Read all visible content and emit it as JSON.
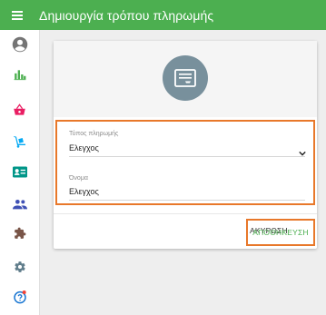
{
  "appbar": {
    "title": "Δημιουργία τρόπου πληρωμής",
    "menu_icon": "hamburger-menu-icon",
    "color": "#4caf50"
  },
  "sidebar": {
    "items": [
      {
        "icon": "account-circle-icon",
        "color": "#757575"
      },
      {
        "icon": "bar-chart-icon",
        "color": "#4caf50"
      },
      {
        "icon": "basket-icon",
        "color": "#e91e63"
      },
      {
        "icon": "delivery-icon",
        "color": "#03a9f4"
      },
      {
        "icon": "id-card-icon",
        "color": "#009688"
      },
      {
        "icon": "people-icon",
        "color": "#3f51b5"
      },
      {
        "icon": "puzzle-icon",
        "color": "#795548"
      },
      {
        "icon": "gear-icon",
        "color": "#607d8b"
      },
      {
        "icon": "help-icon",
        "color": "#1976d2"
      }
    ]
  },
  "form": {
    "avatar_icon": "receipt-icon",
    "payment_type": {
      "label": "Τύπος πληρωμής",
      "value": "Ελεγχος"
    },
    "name": {
      "label": "Όνομα",
      "value": "Ελεγχος"
    },
    "cancel_label": "ΑΚΥΡΩΣΗ",
    "save_label": "ΑΠΟΘΗΚΕΥΣΗ"
  },
  "colors": {
    "accent": "#4caf50",
    "highlight": "#e8782a"
  }
}
